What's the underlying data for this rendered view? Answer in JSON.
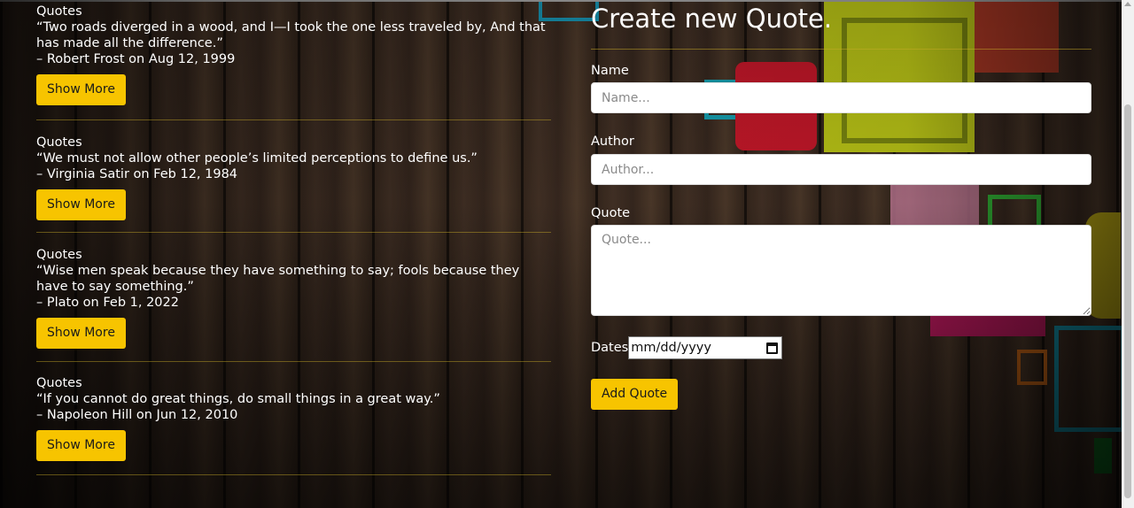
{
  "quotes": [
    {
      "kind": "Quotes",
      "text": "“Two roads diverged in a wood, and I—I took the one less traveled by, And that has made all the difference.”",
      "meta": "– Robert Frost on Aug 12, 1999",
      "button": "Show More"
    },
    {
      "kind": "Quotes",
      "text": "“We must not allow other people’s limited perceptions to define us.”",
      "meta": "– Virginia Satir on Feb 12, 1984",
      "button": "Show More"
    },
    {
      "kind": "Quotes",
      "text": "“Wise men speak because they have something to say; fools because they have to say something.”",
      "meta": "– Plato on Feb 1, 2022",
      "button": "Show More"
    },
    {
      "kind": "Quotes",
      "text": "“If you cannot do great things, do small things in a great way.”",
      "meta": "– Napoleon Hill on Jun 12, 2010",
      "button": "Show More"
    }
  ],
  "form": {
    "title": "Create new Quote.",
    "name_label": "Name",
    "name_placeholder": "Name...",
    "author_label": "Author",
    "author_placeholder": "Author...",
    "quote_label": "Quote",
    "quote_placeholder": "Quote...",
    "dates_label": "Dates",
    "date_value": "mm/dd/yyyy",
    "submit_label": "Add Quote"
  },
  "colors": {
    "accent": "#f7c400",
    "divider": "#c8aa28"
  }
}
